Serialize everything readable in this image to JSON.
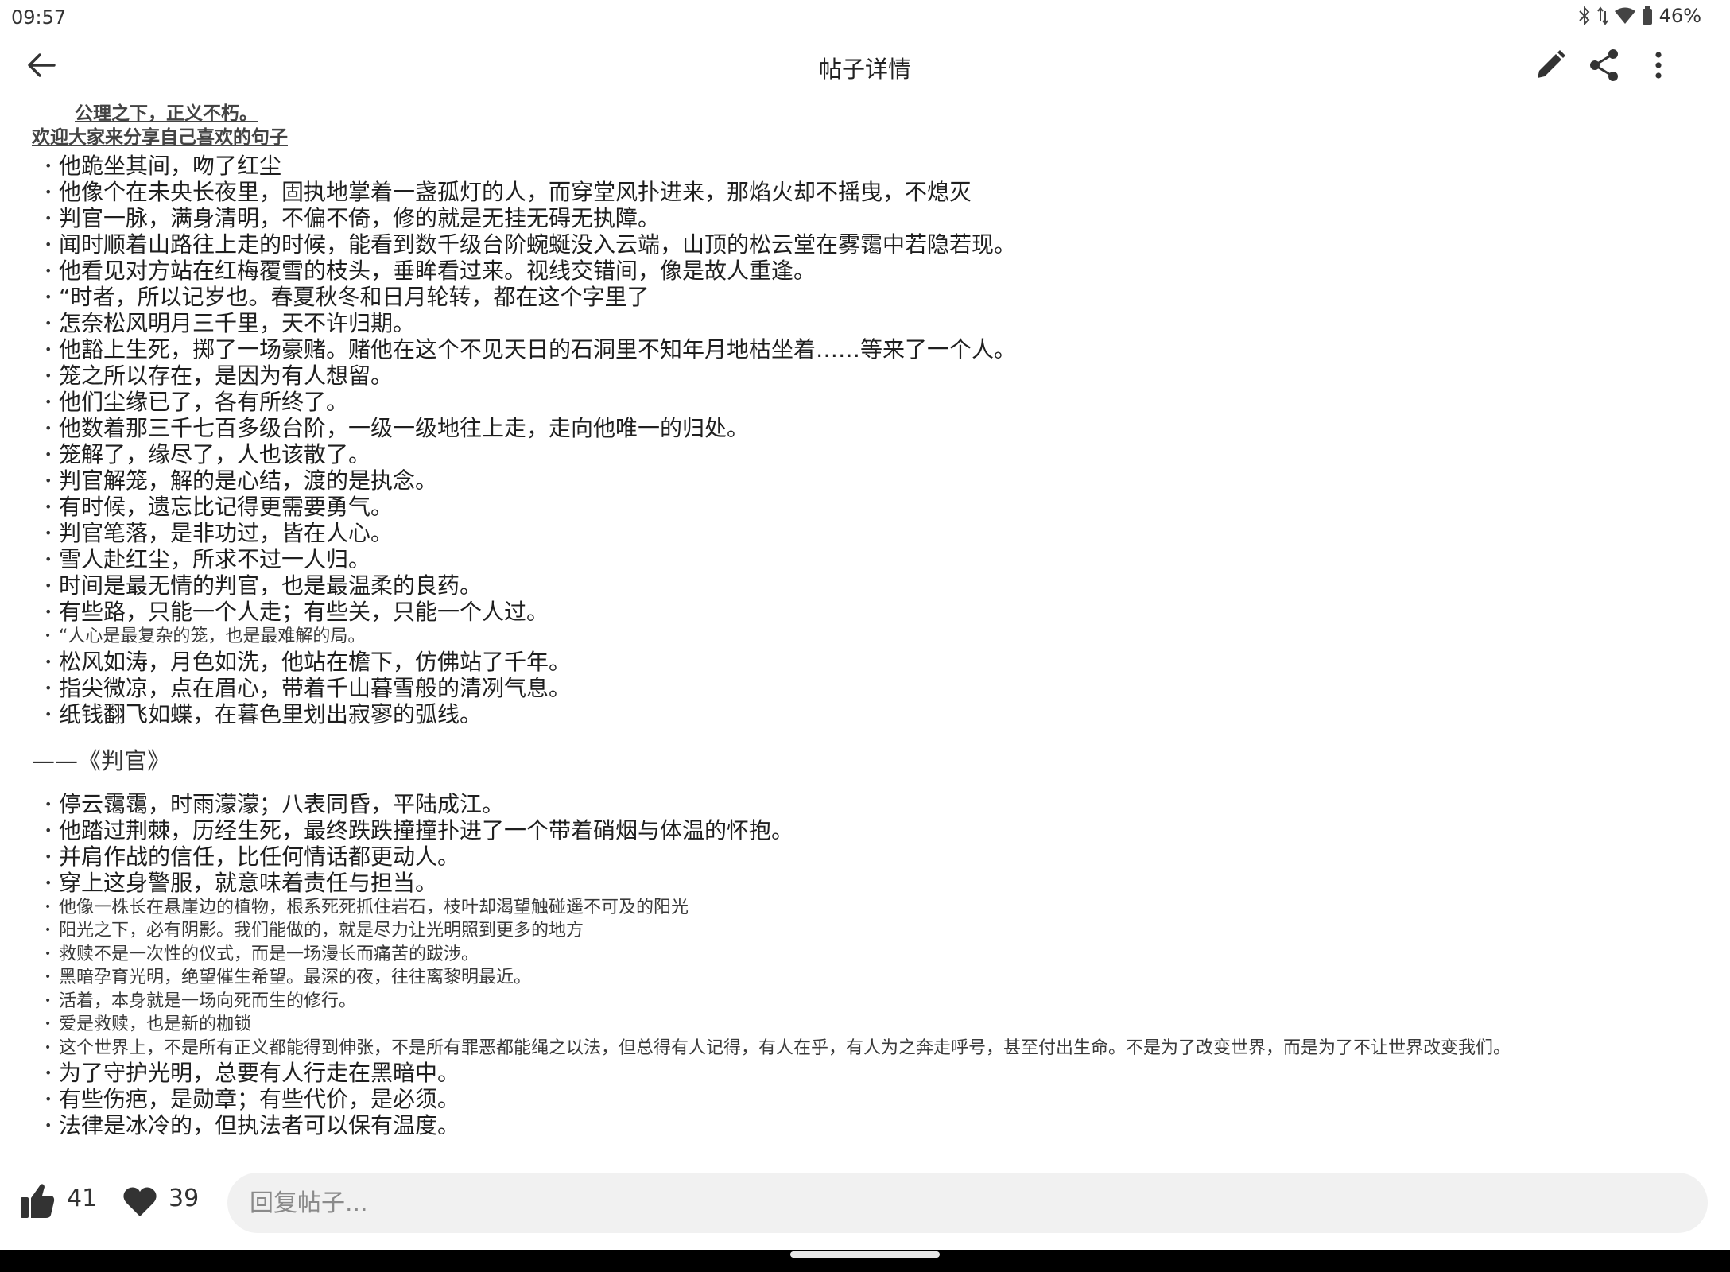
{
  "status_bar": {
    "time": "09:57",
    "battery": "46%"
  },
  "app_bar": {
    "title": "帖子详情"
  },
  "post": {
    "heading1": "公理之下，正义不朽。",
    "heading2": "欢迎大家来分享自己喜欢的句子",
    "section1": [
      "他跪坐其间，吻了红尘",
      "他像个在未央长夜里，固执地掌着一盏孤灯的人，而穿堂风扑进来，那焰火却不摇曳，不熄灭",
      "判官一脉，满身清明，不偏不倚，修的就是无挂无碍无执障。",
      "闻时顺着山路往上走的时候，能看到数千级台阶蜿蜒没入云端，山顶的松云堂在雾霭中若隐若现。",
      "他看见对方站在红梅覆雪的枝头，垂眸看过来。视线交错间，像是故人重逢。",
      "“时者，所以记岁也。春夏秋冬和日月轮转，都在这个字里了",
      "怎奈松风明月三千里，天不许归期。",
      "他豁上生死，掷了一场豪赌。赌他在这个不见天日的石洞里不知年月地枯坐着……等来了一个人。",
      "笼之所以存在，是因为有人想留。",
      "他们尘缘已了，各有所终了。",
      "他数着那三千七百多级台阶，一级一级地往上走，走向他唯一的归处。",
      "笼解了，缘尽了，人也该散了。",
      "判官解笼，解的是心结，渡的是执念。",
      "有时候，遗忘比记得更需要勇气。",
      "判官笔落，是非功过，皆在人心。",
      "雪人赴红尘，所求不过一人归。",
      "时间是最无情的判官，也是最温柔的良药。",
      "有些路，只能一个人走；有些关，只能一个人过。",
      "“人心是最复杂的笼，也是最难解的局。",
      "松风如涛，月色如洗，他站在檐下，仿佛站了千年。",
      "指尖微凉，点在眉心，带着千山暮雪般的清冽气息。",
      "纸钱翻飞如蝶，在暮色里划出寂寥的弧线。"
    ],
    "divider": "——《判官》",
    "section2": [
      "停云霭霭，时雨濛濛；八表同昏，平陆成江。",
      "他踏过荆棘，历经生死，最终跌跌撞撞扑进了一个带着硝烟与体温的怀抱。",
      "并肩作战的信任，比任何情话都更动人。",
      "穿上这身警服，就意味着责任与担当。",
      "他像一株长在悬崖边的植物，根系死死抓住岩石，枝叶却渴望触碰遥不可及的阳光",
      "阳光之下，必有阴影。我们能做的，就是尽力让光明照到更多的地方",
      "救赎不是一次性的仪式，而是一场漫长而痛苦的跋涉。",
      "黑暗孕育光明，绝望催生希望。最深的夜，往往离黎明最近。",
      "活着，本身就是一场向死而生的修行。",
      "爱是救赎，也是新的枷锁",
      "这个世界上，不是所有正义都能得到伸张，不是所有罪恶都能绳之以法，但总得有人记得，有人在乎，有人为之奔走呼号，甚至付出生命。不是为了改变世界，而是为了不让世界改变我们。",
      "为了守护光明，总要有人行走在黑暗中。",
      "有些伤疤，是勋章；有些代价，是必须。",
      "法律是冰冷的，但执法者可以保有温度。"
    ]
  },
  "bottom_bar": {
    "like_count": "41",
    "favorite_count": "39",
    "reply_placeholder": "回复帖子..."
  },
  "icons": {
    "back": "arrow-back-icon",
    "edit": "pencil-icon",
    "share": "share-icon",
    "more": "more-vert-icon",
    "like": "thumb-up-icon",
    "favorite": "heart-icon"
  }
}
